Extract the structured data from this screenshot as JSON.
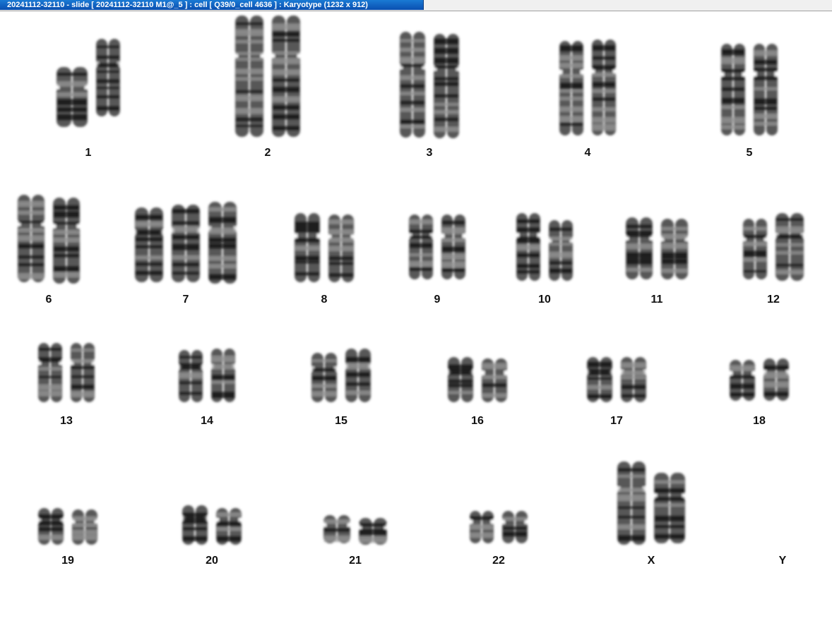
{
  "window": {
    "title": "20241112-32110 - slide [ 20241112-32110 M1@_5 ] : cell [ Q39/0_cell 4636 ] : Karyotype  (1232 x 912)",
    "title_bg": "#0a5fc4",
    "title_fg": "#ffffff"
  },
  "karyotype": {
    "background": "#ffffff",
    "chromosome_color": "#3a3a3a",
    "band_color": "#0d0d0d",
    "pairs": [
      {
        "label": "1",
        "count": 2
      },
      {
        "label": "2",
        "count": 2
      },
      {
        "label": "3",
        "count": 2
      },
      {
        "label": "4",
        "count": 2
      },
      {
        "label": "5",
        "count": 2
      },
      {
        "label": "6",
        "count": 2
      },
      {
        "label": "7",
        "count": 3
      },
      {
        "label": "8",
        "count": 2
      },
      {
        "label": "9",
        "count": 2
      },
      {
        "label": "10",
        "count": 2
      },
      {
        "label": "11",
        "count": 2
      },
      {
        "label": "12",
        "count": 2
      },
      {
        "label": "13",
        "count": 2
      },
      {
        "label": "14",
        "count": 2
      },
      {
        "label": "15",
        "count": 2
      },
      {
        "label": "16",
        "count": 2
      },
      {
        "label": "17",
        "count": 2
      },
      {
        "label": "18",
        "count": 2
      },
      {
        "label": "19",
        "count": 2
      },
      {
        "label": "20",
        "count": 2
      },
      {
        "label": "21",
        "count": 2
      },
      {
        "label": "22",
        "count": 2
      },
      {
        "label": "X",
        "count": 2
      },
      {
        "label": "Y",
        "count": 0
      }
    ]
  }
}
